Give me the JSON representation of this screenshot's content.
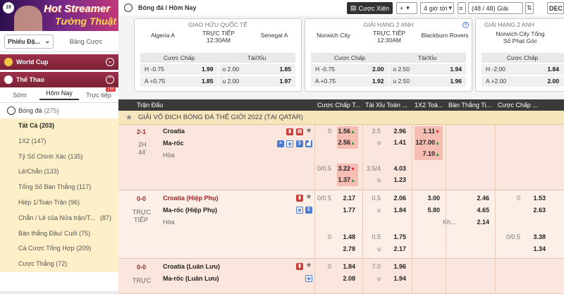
{
  "banner": {
    "logo": "18",
    "title1": "Hot Streamer",
    "title2": "Tường Thuật"
  },
  "left": {
    "dropdown": "Phiếu Đặ...",
    "tab2": "Bảng Cược",
    "worldcup": "World Cup",
    "thethao": "Thể Thao",
    "tabs": [
      "Sớm",
      "Hôm Nay",
      "Trực tiếp"
    ],
    "live_badge": "150",
    "sport": "Bóng đá",
    "sport_count": "(275)",
    "menu": [
      {
        "label": "Tất Cả (203)",
        "count": ""
      },
      {
        "label": "1X2 (147)",
        "count": ""
      },
      {
        "label": "Tỷ Số Chính Xác (135)",
        "count": ""
      },
      {
        "label": "Lẻ/Chẵn (133)",
        "count": ""
      },
      {
        "label": "Tổng Số Bàn Thắng (117)",
        "count": ""
      },
      {
        "label": "Hiệp 1/Toàn Trận (96)",
        "count": ""
      },
      {
        "label": "Chẵn / Lẻ của Nửa trận/T...",
        "count": "(87)"
      },
      {
        "label": "Bàn thắng Đầu/ Cuối (75)",
        "count": ""
      },
      {
        "label": "Cá Cược Tổng Hợp (209)",
        "count": ""
      },
      {
        "label": "Cược Thắng (72)",
        "count": ""
      }
    ]
  },
  "topbar": {
    "breadcrumb": "Bóng đá / Hôm Nay",
    "parlay": "Cược Xiên",
    "plus": "+",
    "time": "4 giờ tới",
    "count": "(48 / 48) Giải",
    "dec": "DEC"
  },
  "cards": [
    {
      "league": "GIAO HỮU QUỐC TẾ",
      "home": "Algeria A",
      "status": "TRỰC TIẾP",
      "time": "12:30AM",
      "away": "Senegal A",
      "h1": "Cược Chấp",
      "h2": "Tài/Xỉu",
      "r1": [
        "H -0.75",
        "1.99",
        "o 2.00",
        "1.85"
      ],
      "r2": [
        "A +0.75",
        "1.85",
        "u 2.00",
        "1.97"
      ]
    },
    {
      "league": "GIẢI HẠNG 2 ANH",
      "home": "Norwich City",
      "status": "TRỰC TIẾP",
      "time": "12:30AM",
      "away": "Blackburn Rovers",
      "h1": "Cược Chấp",
      "h2": "Tài/Xỉu",
      "r1": [
        "H -0.75",
        "2.00",
        "o 2.50",
        "1.94"
      ],
      "r2": [
        "A +0.75",
        "1.92",
        "u 2.50",
        "1.96"
      ]
    },
    {
      "league": "GIẢI HẠNG 2 ANH",
      "home": "Norwich City Tổng",
      "home2": "Số Phạt Góc",
      "status": "",
      "time": "",
      "away": "",
      "h1": "Cược Chấp",
      "h2": "",
      "r1": [
        "H -2.00",
        "1.84",
        "",
        ""
      ],
      "r2": [
        "A +2.00",
        "2.00",
        "",
        ""
      ]
    }
  ],
  "table": {
    "headers": [
      "Trận Đấu",
      "Cược Chấp T...",
      "Tài Xỉu Toàn ...",
      "1X2 Toà...",
      "Bàn Thắng Ti...",
      "Cược Chấp ..."
    ],
    "league": "GIẢI VÔ ĐỊCH BÓNG ĐÁ THẾ GIỚI 2022 (TẠI QATAR)",
    "matches": [
      {
        "score": "2-1",
        "period": "2H",
        "minute": "44'",
        "home": "Croatia",
        "away": "Ma-rốc",
        "draw": "Hòa"
      },
      {
        "score": "0-0",
        "period": "TRỰC",
        "minute": "TIẾP",
        "home": "Croatia (Hiệp Phụ)",
        "away": "Ma-rốc (Hiệp Phụ)",
        "draw": "Hòa"
      },
      {
        "score": "0-0",
        "period": "TRỰC",
        "minute": "",
        "home": "Croatia (Luân Lưu)",
        "away": "Ma-rốc (Luân Lưu)",
        "draw": ""
      }
    ],
    "odds": {
      "m1": {
        "hdp1": "0",
        "hdp1a": "1.56",
        "hdp1b": "2.56",
        "ou1": "3.5",
        "ou1a": "2.96",
        "ou1u": "u",
        "ou1b": "1.41",
        "x1": "1.11",
        "x2": "127.00",
        "x3": "7.10",
        "hdp2": "0/0.5",
        "hdp2a": "3.22",
        "hdp2b": "1.37",
        "ou2": "3.5/4",
        "ou2a": "4.03",
        "ou2u": "u",
        "ou2b": "1.23"
      },
      "m2": {
        "hdp1": "0/0.5",
        "hdp1a": "2.17",
        "hdp1b": "1.77",
        "ou1": "0.5",
        "ou1a": "2.06",
        "ou1u": "u",
        "ou1b": "1.84",
        "x1": "3.00",
        "x2": "5.80",
        "g1": "2.46",
        "g2": "4.65",
        "gk": "Kh...",
        "g3": "2.14",
        "c1": "0",
        "c1a": "1.53",
        "c1b": "2.63",
        "hdp2": "0",
        "hdp2a": "1.48",
        "hdp2b": "2.78",
        "ou2": "0.5",
        "ou2a": "1.75",
        "ou2u": "u",
        "ou2b": "2.17",
        "c2": "0/0.5",
        "c2a": "3.38",
        "c2b": "1.34"
      },
      "m3": {
        "hdp1": "0",
        "hdp1a": "1.84",
        "hdp1b": "2.08",
        "ou1": "7.0",
        "ou1a": "1.96",
        "ou1u": "u",
        "ou1b": "1.94"
      }
    }
  }
}
